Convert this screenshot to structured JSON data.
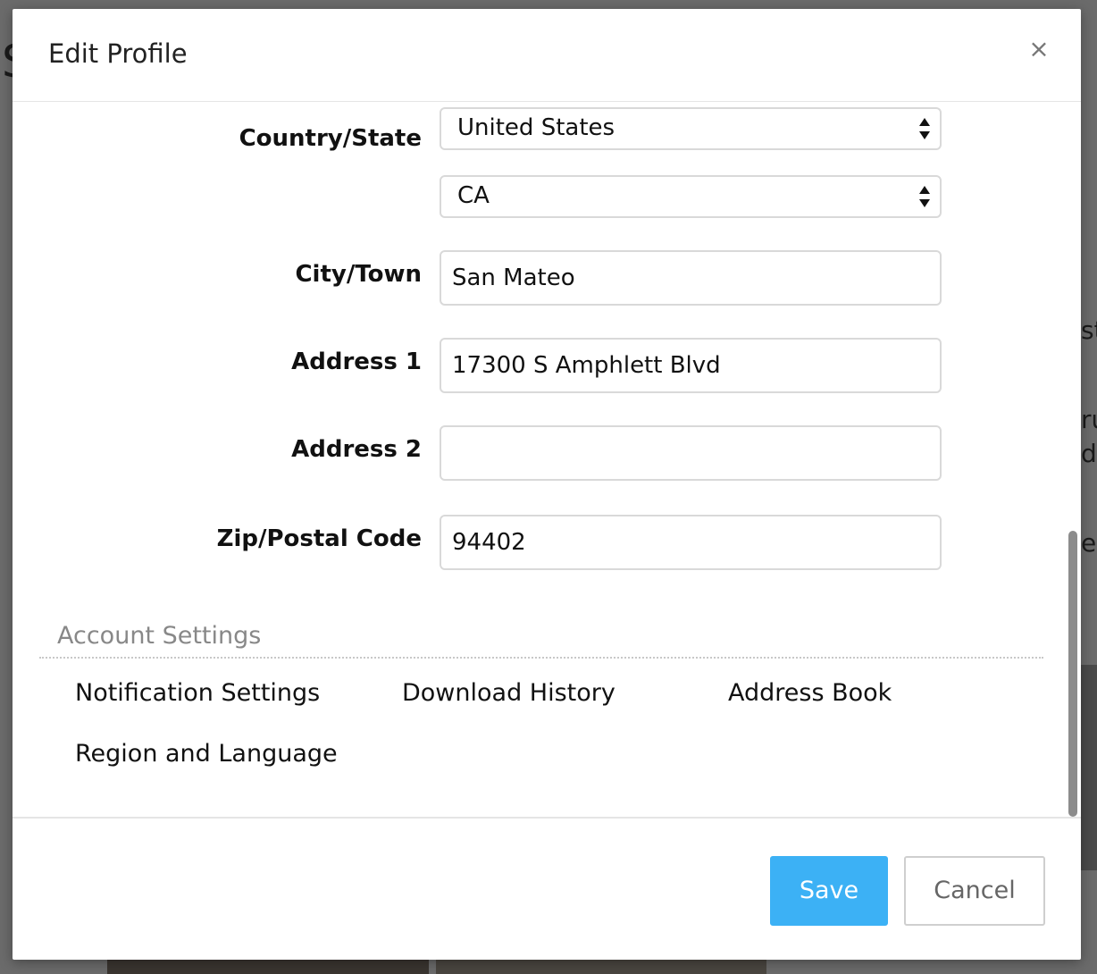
{
  "background": {
    "fragments": [
      "S",
      "st",
      "ru",
      "d",
      "e"
    ]
  },
  "modal": {
    "title": "Edit Profile",
    "close_glyph": "×"
  },
  "form": {
    "country_state_label": "Country/State",
    "country_value": "United States",
    "state_value": "CA",
    "city_label": "City/Town",
    "city_value": "San Mateo",
    "address1_label": "Address 1",
    "address1_value": "17300 S Amphlett Blvd",
    "address2_label": "Address 2",
    "address2_value": "",
    "zip_label": "Zip/Postal Code",
    "zip_value": "94402"
  },
  "account_settings": {
    "title": "Account Settings",
    "links": [
      "Notification Settings",
      "Download History",
      "Address Book",
      "Region and Language"
    ]
  },
  "footer": {
    "save_label": "Save",
    "cancel_label": "Cancel"
  },
  "colors": {
    "primary": "#3cb1f5",
    "overlay": "#5f5f5f",
    "section_title": "#888888"
  }
}
